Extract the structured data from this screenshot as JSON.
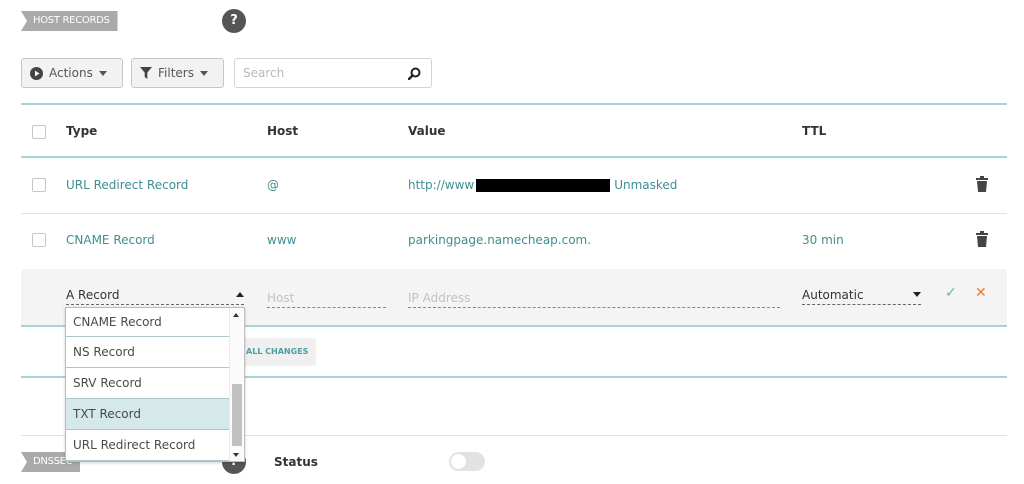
{
  "section": {
    "host_records_tag": "HOST RECORDS",
    "help_glyph": "?",
    "dnssec_tag": "DNSSEC"
  },
  "toolbar": {
    "actions_label": "Actions",
    "filters_label": "Filters",
    "search_placeholder": "Search"
  },
  "table": {
    "columns": [
      "Type",
      "Host",
      "Value",
      "TTL"
    ],
    "rows": [
      {
        "type": "URL Redirect Record",
        "host": "@",
        "value_prefix": "http://www",
        "value_suffix": "Unmasked",
        "ttl": ""
      },
      {
        "type": "CNAME Record",
        "host": "www",
        "value": "parkingpage.namecheap.com.",
        "ttl": "30 min"
      }
    ]
  },
  "new_record": {
    "type_selected": "A Record",
    "host_placeholder": "Host",
    "value_placeholder": "IP Address",
    "ttl_selected": "Automatic",
    "confirm_glyph": "✓",
    "cancel_glyph": "✕"
  },
  "type_options": [
    "CNAME Record",
    "NS Record",
    "SRV Record",
    "TXT Record",
    "URL Redirect Record"
  ],
  "type_options_highlighted": "TXT Record",
  "save_all_label_visible": "ALL CHANGES",
  "dnssec": {
    "status_label": "Status",
    "enabled": false
  },
  "colors": {
    "accent_teal": "#3f8e90",
    "divider_teal": "#a6d3d5",
    "cancel_orange": "#f07b2b",
    "confirm_teal": "#5fb6b8"
  }
}
